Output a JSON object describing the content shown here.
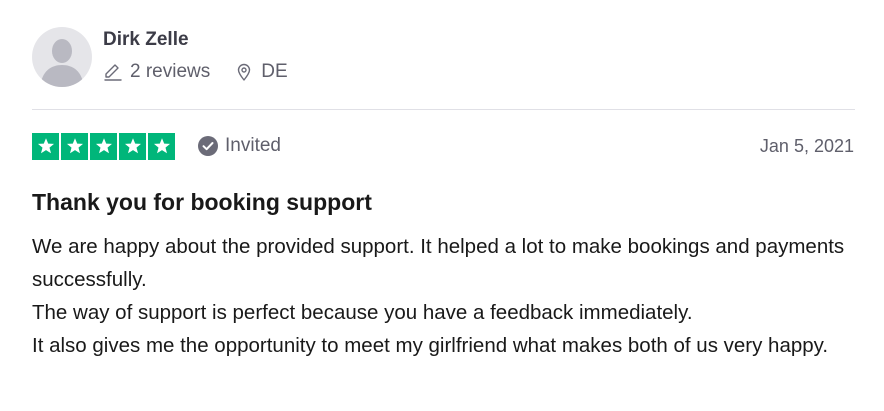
{
  "consumer": {
    "name": "Dirk Zelle",
    "reviews_count": "2 reviews",
    "country": "DE",
    "avatar_icon": "default-avatar-icon",
    "reviews_icon": "pencil-icon",
    "location_icon": "location-pin-icon"
  },
  "rating": {
    "stars": 5,
    "max_stars": 5,
    "star_color": "#00b67a",
    "star_icon": "star-icon"
  },
  "verification": {
    "label": "Invited",
    "icon": "check-circle-icon"
  },
  "review": {
    "date": "Jan 5, 2021",
    "title": "Thank you for booking support",
    "paragraphs": [
      "We are happy about the provided support. It helped a lot to make bookings and payments successfully.",
      "The way of support is perfect because you have a feedback immediately.",
      "It also gives me the opportunity to meet my girlfriend what makes both of us very happy."
    ]
  }
}
